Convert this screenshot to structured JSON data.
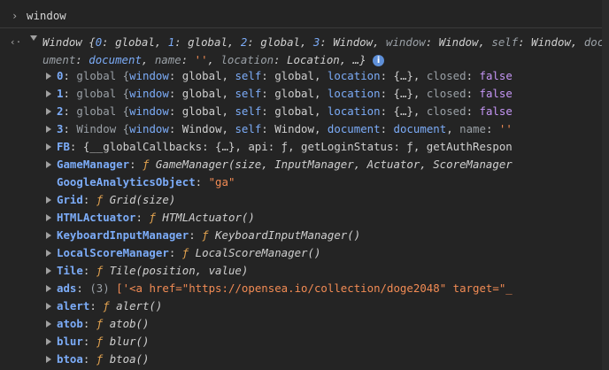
{
  "console": {
    "prompt_symbol": "›",
    "input": "window",
    "return_symbol": "‹·",
    "summary": {
      "a": "Window {",
      "k0": "0",
      "v0": "global",
      "k1": "1",
      "v1": "global",
      "k2": "2",
      "v2": "global",
      "k3": "3",
      "v3": "Window",
      "kwin": "window",
      "vwin": "Window",
      "kself": "self",
      "vself": "Window",
      "kdoc": "document",
      "vdoc": "document",
      "kname": "name",
      "vname": "''",
      "kloc": "location",
      "vloc": "Location",
      "tail": ", …}",
      "info": "i"
    },
    "rows": [
      {
        "key": "0",
        "pre": " global {",
        "k1": "window",
        "v1": "global",
        "k2": "self",
        "v2": "global",
        "k3": "location",
        "v3": "{…}",
        "k4": "closed",
        "v4": "false"
      },
      {
        "key": "1",
        "pre": " global {",
        "k1": "window",
        "v1": "global",
        "k2": "self",
        "v2": "global",
        "k3": "location",
        "v3": "{…}",
        "k4": "closed",
        "v4": "false"
      },
      {
        "key": "2",
        "pre": " global {",
        "k1": "window",
        "v1": "global",
        "k2": "self",
        "v2": "global",
        "k3": "location",
        "v3": "{…}",
        "k4": "closed",
        "v4": "false"
      },
      {
        "key": "3",
        "pre": " Window {",
        "k1": "window",
        "v1": "Window",
        "k2": "self",
        "v2": "Window",
        "k3": "document",
        "v3": "document",
        "k4": "name",
        "v4": "''"
      }
    ],
    "fb": {
      "key": "FB",
      "rest": " {__globalCallbacks: {…}, api: ƒ, getLoginStatus: ƒ, getAuthRespon"
    },
    "gamemanager": {
      "key": "GameManager",
      "f": "ƒ",
      "sig": " GameManager(size, InputManager, Actuator, ScoreManager"
    },
    "gaobject": {
      "key": "GoogleAnalyticsObject",
      "val": "\"ga\""
    },
    "grid": {
      "key": "Grid",
      "f": "ƒ",
      "sig": " Grid(size)"
    },
    "htmlactuator": {
      "key": "HTMLActuator",
      "f": "ƒ",
      "sig": " HTMLActuator()"
    },
    "keyboard": {
      "key": "KeyboardInputManager",
      "f": "ƒ",
      "sig": " KeyboardInputManager()"
    },
    "localscore": {
      "key": "LocalScoreManager",
      "f": "ƒ",
      "sig": " LocalScoreManager()"
    },
    "tile": {
      "key": "Tile",
      "f": "ƒ",
      "sig": " Tile(position, value)"
    },
    "ads": {
      "key": "ads",
      "count": "(3)",
      "rest": " ['<a href=\"https://opensea.io/collection/doge2048\" target=\"_"
    },
    "alert": {
      "key": "alert",
      "f": "ƒ",
      "sig": " alert()"
    },
    "atob": {
      "key": "atob",
      "f": "ƒ",
      "sig": " atob()"
    },
    "blur": {
      "key": "blur",
      "f": "ƒ",
      "sig": " blur()"
    },
    "btoa": {
      "key": "btoa",
      "f": "ƒ",
      "sig": " btoa()"
    }
  },
  "colors": {
    "background": "#242424",
    "key": "#7cacf8",
    "function": "#e3a34f",
    "string": "#f28b54",
    "keyword": "#c596f5",
    "number": "#9980ff"
  }
}
